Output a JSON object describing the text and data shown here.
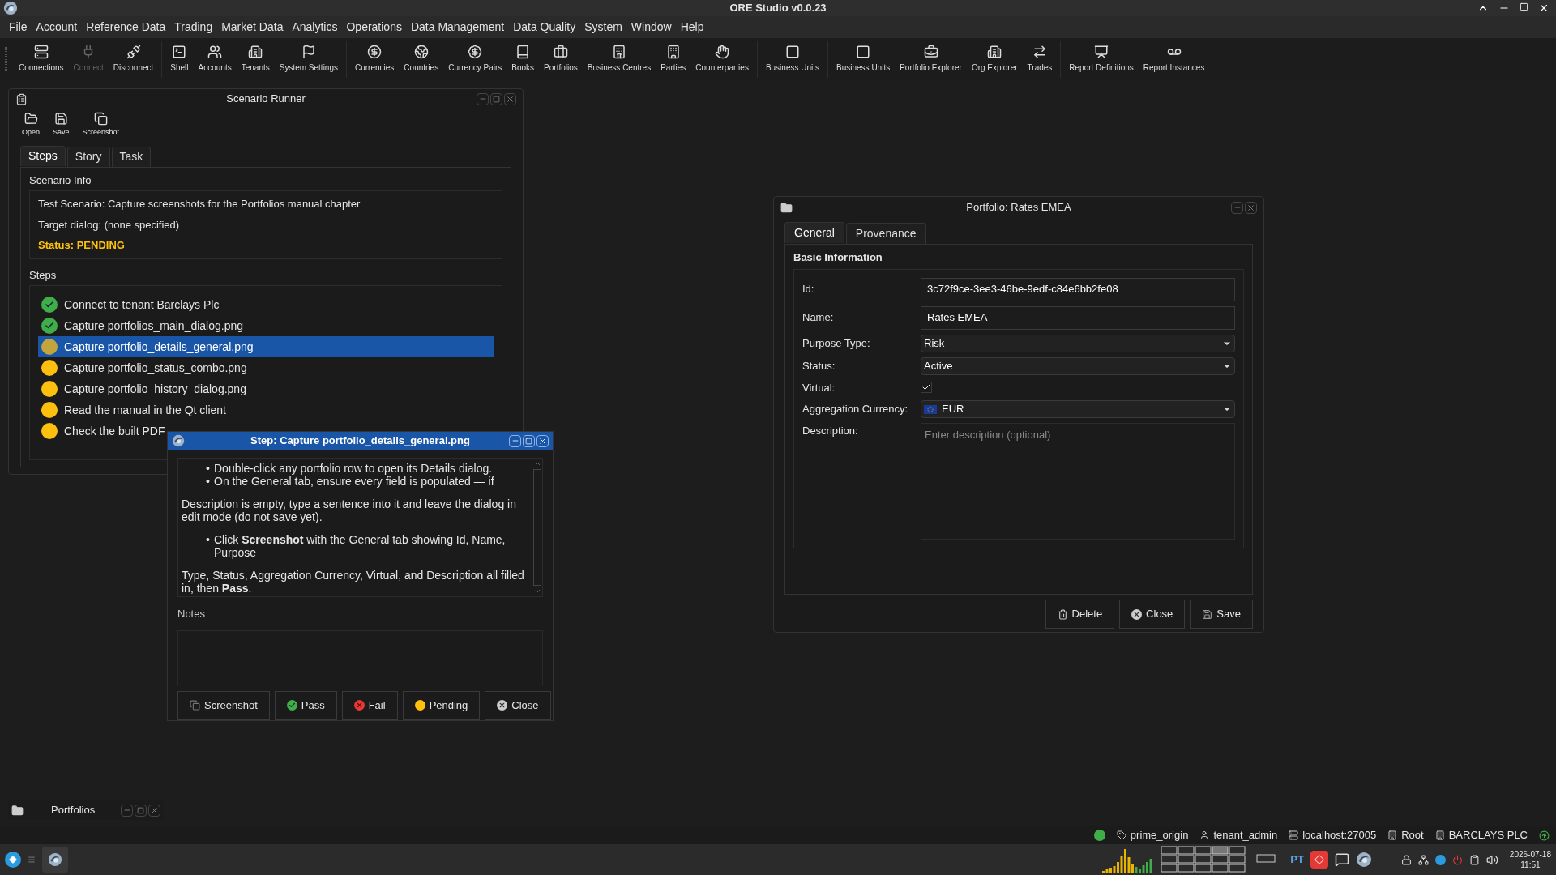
{
  "window": {
    "title": "ORE Studio v0.0.23"
  },
  "menu": [
    "File",
    "Account",
    "Reference Data",
    "Trading",
    "Market Data",
    "Analytics",
    "Operations",
    "Data Management",
    "Data Quality",
    "System",
    "Window",
    "Help"
  ],
  "toolbar": [
    {
      "items": [
        {
          "label": "Connections",
          "disabled": false
        },
        {
          "label": "Connect",
          "disabled": true
        },
        {
          "label": "Disconnect",
          "disabled": false
        }
      ]
    },
    {
      "items": [
        {
          "label": "Shell",
          "disabled": false
        },
        {
          "label": "Accounts",
          "disabled": false
        },
        {
          "label": "Tenants",
          "disabled": false
        },
        {
          "label": "System Settings",
          "disabled": false
        }
      ]
    },
    {
      "items": [
        {
          "label": "Currencies",
          "disabled": false
        },
        {
          "label": "Countries",
          "disabled": false
        },
        {
          "label": "Currency Pairs",
          "disabled": false
        },
        {
          "label": "Books",
          "disabled": false
        },
        {
          "label": "Portfolios",
          "disabled": false
        },
        {
          "label": "Business Centres",
          "disabled": false
        },
        {
          "label": "Parties",
          "disabled": false
        },
        {
          "label": "Counterparties",
          "disabled": false
        }
      ]
    },
    {
      "items": [
        {
          "label": "Business Units",
          "disabled": false
        }
      ]
    },
    {
      "items": [
        {
          "label": "Business Units",
          "disabled": false
        },
        {
          "label": "Portfolio Explorer",
          "disabled": false
        },
        {
          "label": "Org Explorer",
          "disabled": false
        },
        {
          "label": "Trades",
          "disabled": false
        }
      ]
    },
    {
      "items": [
        {
          "label": "Report Definitions",
          "disabled": false
        },
        {
          "label": "Report Instances",
          "disabled": false
        }
      ]
    }
  ],
  "scenario_runner": {
    "title": "Scenario Runner",
    "tools": [
      "Open",
      "Save",
      "Screenshot"
    ],
    "tabs": [
      {
        "label": "Steps",
        "selected": true
      },
      {
        "label": "Story",
        "selected": false
      },
      {
        "label": "Task",
        "selected": false
      }
    ],
    "info_title": "Scenario Info",
    "info_lines": [
      {
        "kind": "text",
        "text": "Test Scenario: Capture screenshots for the Portfolios manual chapter"
      },
      {
        "kind": "text",
        "text": "Target dialog: (none specified)"
      },
      {
        "kind": "status",
        "text": "Status: PENDING"
      }
    ],
    "steps_title": "Steps",
    "steps": [
      {
        "text": "Connect to tenant Barclays Plc",
        "passed": true,
        "selected": false
      },
      {
        "text": "Capture portfolios_main_dialog.png",
        "passed": true,
        "selected": false
      },
      {
        "text": "Capture portfolio_details_general.png",
        "passed": false,
        "selected": true
      },
      {
        "text": "Capture portfolio_status_combo.png",
        "passed": false,
        "selected": false
      },
      {
        "text": "Capture portfolio_history_dialog.png",
        "passed": false,
        "selected": false
      },
      {
        "text": "Read the manual in the Qt client",
        "passed": false,
        "selected": false
      },
      {
        "text": "Check the built PDF",
        "passed": false,
        "selected": false
      }
    ]
  },
  "step_dialog": {
    "title": "Step: Capture portfolio_details_general.png",
    "instructions": [
      {
        "kind": "bullet",
        "marker": "•",
        "text": "Double-click any portfolio row to open its Details dialog."
      },
      {
        "kind": "bullet",
        "marker": "•",
        "text": "On the General tab, ensure every field is populated — if"
      },
      {
        "kind": "paragraph",
        "text": "Description is empty, type a sentence into it and leave the dialog in edit mode (do not save yet)."
      },
      {
        "kind": "bullet",
        "marker": "•",
        "text": "Click **Screenshot** with the General tab showing Id, Name, Purpose"
      },
      {
        "kind": "paragraph",
        "text": "Type, Status, Aggregation Currency, Virtual, and Description all filled in, then **Pass**."
      }
    ],
    "notes_label": "Notes",
    "buttons": [
      {
        "kind": "screenshot",
        "label": "Screenshot"
      },
      {
        "kind": "pass",
        "label": "Pass"
      },
      {
        "kind": "fail",
        "label": "Fail"
      },
      {
        "kind": "pending",
        "label": "Pending"
      },
      {
        "kind": "close",
        "label": "Close"
      }
    ]
  },
  "portfolio_dialog": {
    "title": "Portfolio: Rates EMEA",
    "tabs": [
      {
        "label": "General",
        "selected": true
      },
      {
        "label": "Provenance",
        "selected": false
      }
    ],
    "section": "Basic Information",
    "fields": [
      {
        "kind": "text",
        "label": "Id:",
        "value": "3c72f9ce-3ee3-46be-9edf-c84e6bb2fe08"
      },
      {
        "kind": "text",
        "label": "Name:",
        "value": "Rates EMEA"
      },
      {
        "kind": "combo",
        "label": "Purpose Type:",
        "value": "Risk"
      },
      {
        "kind": "combo",
        "label": "Status:",
        "value": "Active"
      },
      {
        "kind": "checkbox",
        "label": "Virtual:",
        "checked": true
      },
      {
        "kind": "currency",
        "label": "Aggregation Currency:",
        "value": "EUR"
      },
      {
        "kind": "textarea",
        "label": "Description:",
        "placeholder": "Enter description (optional)"
      }
    ],
    "buttons": [
      {
        "kind": "delete",
        "label": "Delete"
      },
      {
        "kind": "close",
        "label": "Close"
      },
      {
        "kind": "save",
        "label": "Save"
      }
    ]
  },
  "minimized_window": {
    "title": "Portfolios"
  },
  "status_bar": {
    "connected": true,
    "items": [
      {
        "kind": "tag",
        "text": "prime_origin"
      },
      {
        "kind": "user",
        "text": "tenant_admin"
      },
      {
        "kind": "server",
        "text": "localhost:27005"
      },
      {
        "kind": "building",
        "text": "Root"
      },
      {
        "kind": "building",
        "text": "BARCLAYS PLC"
      }
    ]
  },
  "taskbar": {
    "keyboard_layout": "PT",
    "date": "2026-07-18",
    "time": "11:51"
  }
}
